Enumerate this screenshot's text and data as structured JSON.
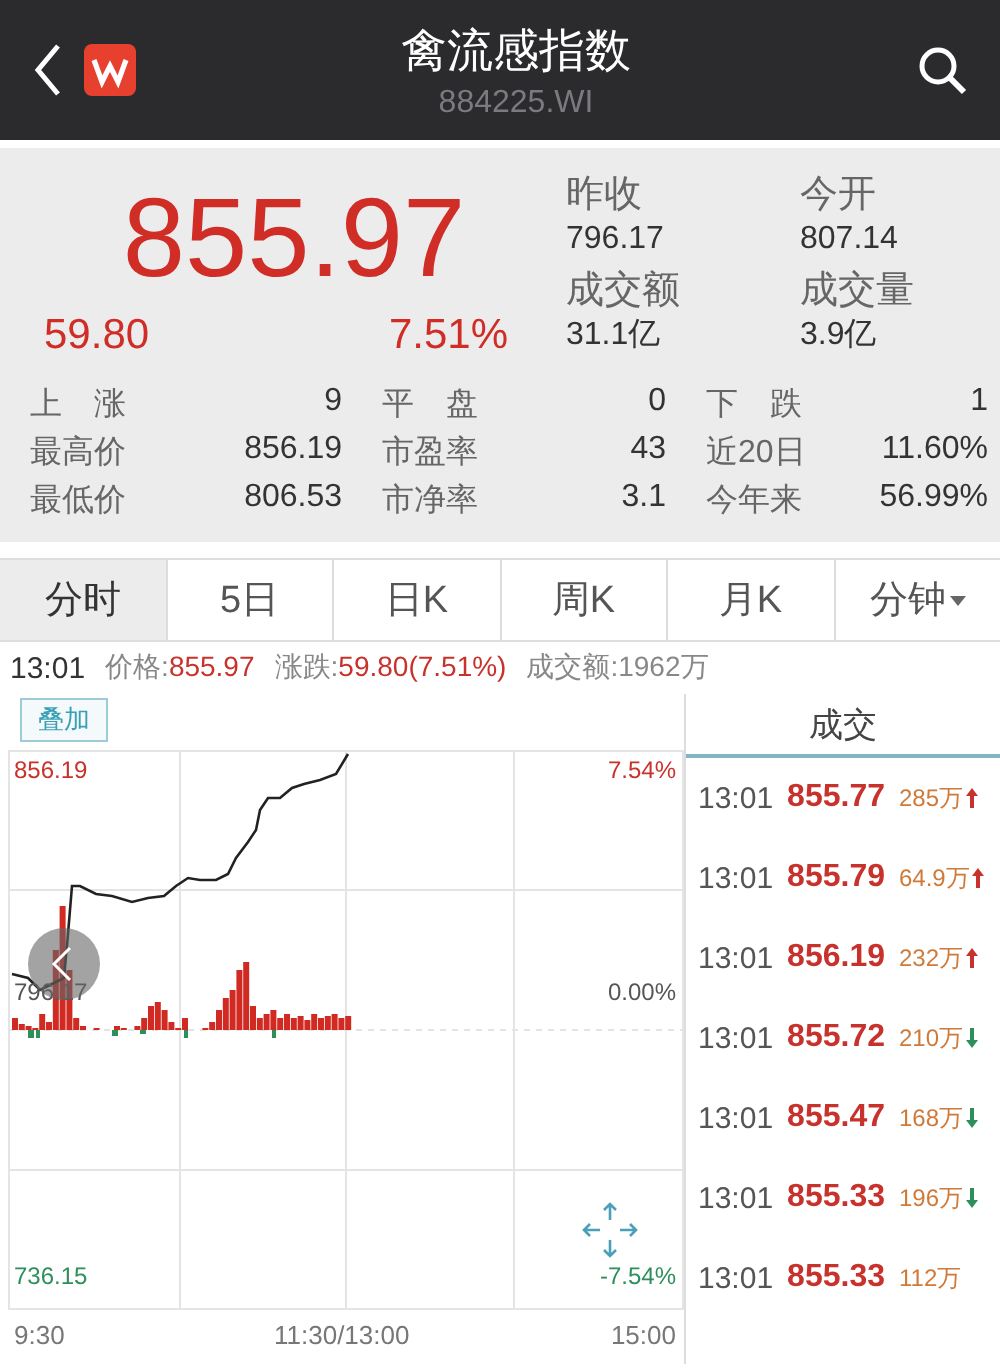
{
  "header": {
    "title": "禽流感指数",
    "code": "884225.WI"
  },
  "quote": {
    "price": "855.97",
    "change": "59.80",
    "change_pct": "7.51%",
    "fields": [
      {
        "label": "昨收",
        "value": "796.17"
      },
      {
        "label": "今开",
        "value": "807.14"
      },
      {
        "label": "成交额",
        "value": "31.1亿"
      },
      {
        "label": "成交量",
        "value": "3.9亿"
      }
    ]
  },
  "stats": [
    {
      "label": "上　涨",
      "value": "9"
    },
    {
      "label": "平　盘",
      "value": "0"
    },
    {
      "label": "下　跌",
      "value": "1"
    },
    {
      "label": "最高价",
      "value": "856.19"
    },
    {
      "label": "市盈率",
      "value": "43"
    },
    {
      "label": "近20日",
      "value": "11.60%"
    },
    {
      "label": "最低价",
      "value": "806.53"
    },
    {
      "label": "市净率",
      "value": "3.1"
    },
    {
      "label": "今年来",
      "value": "56.99%"
    }
  ],
  "tabs": [
    {
      "label": "分时",
      "selected": true
    },
    {
      "label": "5日",
      "selected": false
    },
    {
      "label": "日K",
      "selected": false
    },
    {
      "label": "周K",
      "selected": false
    },
    {
      "label": "月K",
      "selected": false
    },
    {
      "label": "分钟",
      "selected": false,
      "dropdown": true
    }
  ],
  "info": {
    "time": "13:01",
    "price_label": "价格:",
    "price": "855.97",
    "change_label": "涨跌:",
    "change": "59.80(7.51%)",
    "amount_label": "成交额:",
    "amount": "1962万"
  },
  "chart": {
    "overlay_button": "叠加",
    "top_price": "856.19",
    "mid_price": "796.17",
    "bottom_price": "736.15",
    "top_pct": "7.54%",
    "mid_pct": "0.00%",
    "bottom_pct": "-7.54%",
    "times": [
      "9:30",
      "11:30/13:00",
      "15:00"
    ]
  },
  "trades": {
    "title": "成交",
    "rows": [
      {
        "time": "13:01",
        "price": "855.77",
        "volume": "285万",
        "kind": "up"
      },
      {
        "time": "13:01",
        "price": "855.79",
        "volume": "64.9万",
        "kind": "up"
      },
      {
        "time": "13:01",
        "price": "856.19",
        "volume": "232万",
        "kind": "up"
      },
      {
        "time": "13:01",
        "price": "855.72",
        "volume": "210万",
        "kind": "down"
      },
      {
        "time": "13:01",
        "price": "855.47",
        "volume": "168万",
        "kind": "down"
      },
      {
        "time": "13:01",
        "price": "855.33",
        "volume": "196万",
        "kind": "down"
      },
      {
        "time": "13:01",
        "price": "855.33",
        "volume": "112万",
        "kind": "plain"
      }
    ]
  }
}
